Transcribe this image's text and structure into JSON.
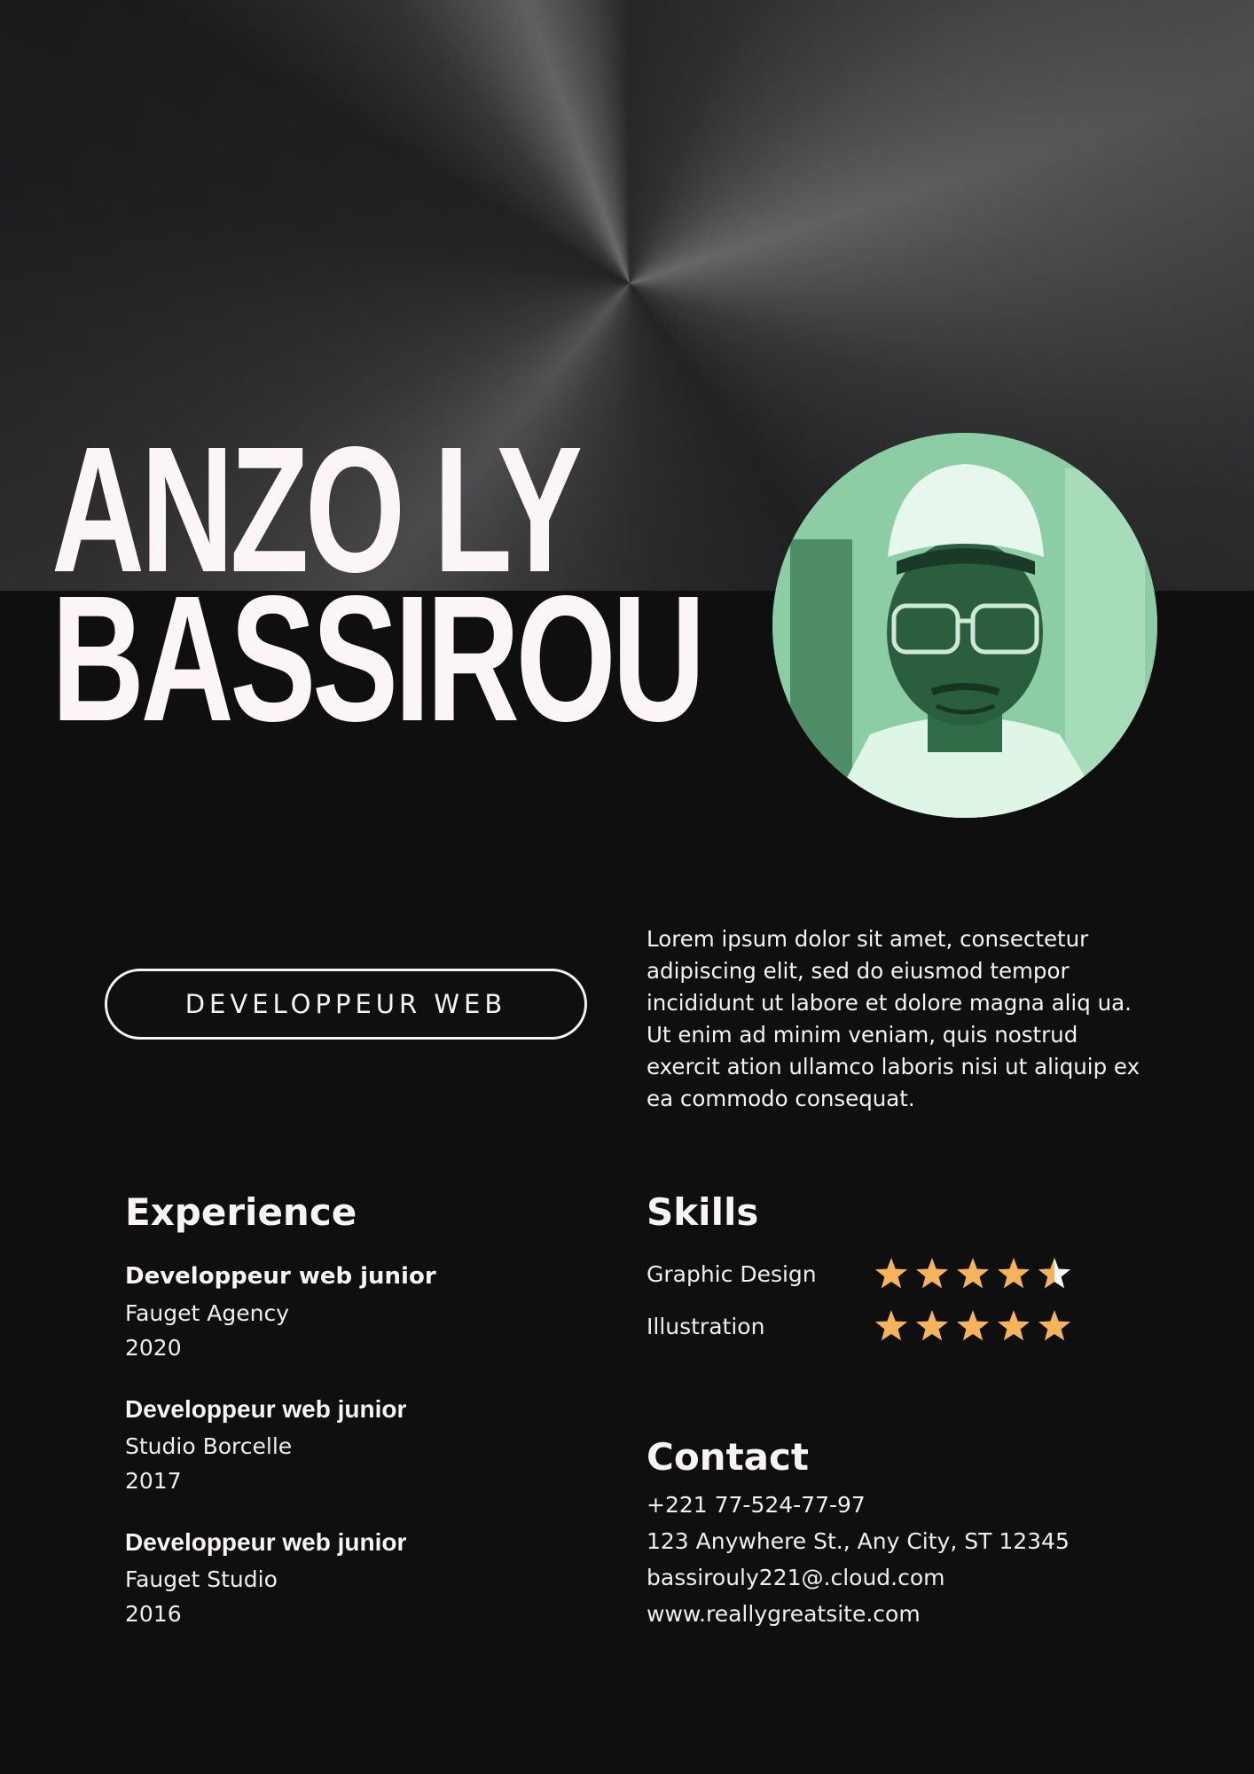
{
  "header": {
    "name_line1": "ANZO LY",
    "name_line2": "BASSIROU"
  },
  "role": "DEVELOPPEUR WEB",
  "bio": "Lorem ipsum dolor sit amet, consectetur adipiscing elit, sed do eiusmod tempor incididunt ut labore et dolore magna aliq ua. Ut enim ad minim veniam, quis nostrud exercit ation ullamco laboris nisi ut aliquip ex ea commodo consequat.",
  "experience": {
    "heading": "Experience",
    "items": [
      {
        "title": "Developpeur web junior",
        "company": "Fauget Agency",
        "year": "2020"
      },
      {
        "title": "Developpeur web junior",
        "company": "Studio Borcelle",
        "year": "2017"
      },
      {
        "title": "Developpeur web junior",
        "company": "Fauget Studio",
        "year": "2016"
      }
    ]
  },
  "skills": {
    "heading": "Skills",
    "items": [
      {
        "label": "Graphic Design",
        "rating": 4.5,
        "max": 5
      },
      {
        "label": "Illustration",
        "rating": 5,
        "max": 5
      }
    ],
    "star_color": "#f5b45a",
    "star_empty_color": "#ffffff"
  },
  "contact": {
    "heading": "Contact",
    "phone": "+221 77-524-77-97",
    "address": "123 Anywhere St., Any City, ST 12345",
    "email": "bassirouly221@.cloud.com",
    "website": "www.reallygreatsite.com"
  }
}
